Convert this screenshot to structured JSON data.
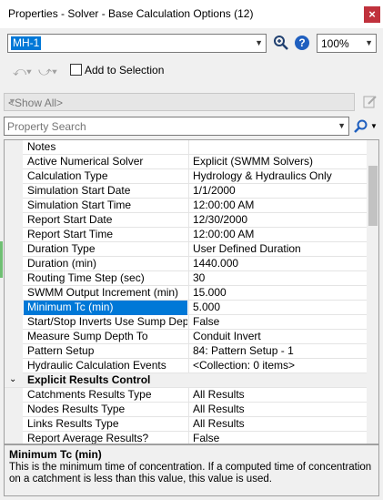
{
  "window": {
    "title": "Properties - Solver - Base Calculation Options (12)",
    "close_glyph": "×"
  },
  "toolbar": {
    "element_value": "MH-1",
    "help_glyph": "?",
    "zoom_value": "100%",
    "add_to_selection_label": "Add to Selection",
    "show_all_value": "<Show All>",
    "search_placeholder": "Property Search"
  },
  "properties": [
    {
      "name": "Notes",
      "value": ""
    },
    {
      "name": "Active Numerical Solver",
      "value": "Explicit (SWMM Solvers)"
    },
    {
      "name": "Calculation Type",
      "value": "Hydrology & Hydraulics Only"
    },
    {
      "name": "Simulation Start Date",
      "value": "1/1/2000"
    },
    {
      "name": "Simulation Start Time",
      "value": "12:00:00 AM"
    },
    {
      "name": "Report Start Date",
      "value": "12/30/2000"
    },
    {
      "name": "Report Start Time",
      "value": "12:00:00 AM"
    },
    {
      "name": "Duration Type",
      "value": "User Defined Duration"
    },
    {
      "name": "Duration (min)",
      "value": "1440.000"
    },
    {
      "name": "Routing Time Step (sec)",
      "value": "30"
    },
    {
      "name": "SWMM Output Increment (min)",
      "value": "15.000"
    },
    {
      "name": "Minimum Tc (min)",
      "value": "5.000"
    },
    {
      "name": "Start/Stop Inverts Use Sump Depth",
      "value": "False"
    },
    {
      "name": "Measure Sump Depth To",
      "value": "Conduit Invert"
    },
    {
      "name": "Pattern Setup",
      "value": "84: Pattern Setup - 1"
    },
    {
      "name": "Hydraulic Calculation Events",
      "value": "<Collection: 0 items>"
    },
    {
      "name": "Explicit Results Control",
      "value": ""
    },
    {
      "name": "Catchments Results Type",
      "value": "All Results"
    },
    {
      "name": "Nodes Results Type",
      "value": "All Results"
    },
    {
      "name": "Links Results Type",
      "value": "All Results"
    },
    {
      "name": "Report Average Results?",
      "value": "False"
    }
  ],
  "selected_index": 11,
  "category_index": 16,
  "description": {
    "title": "Minimum Tc (min)",
    "text": "This is the minimum time of concentration. If a computed time of concentration on a catchment is less than this value, this value is used."
  },
  "colors": {
    "selection": "#0078d7",
    "close": "#c0313c",
    "help": "#1f5fbf"
  },
  "icons": [
    "close-icon",
    "chevron-down-icon",
    "zoom-icon",
    "help-icon",
    "undo-icon",
    "redo-icon",
    "edit-icon",
    "search-icon",
    "collapse-chevron-icon"
  ]
}
